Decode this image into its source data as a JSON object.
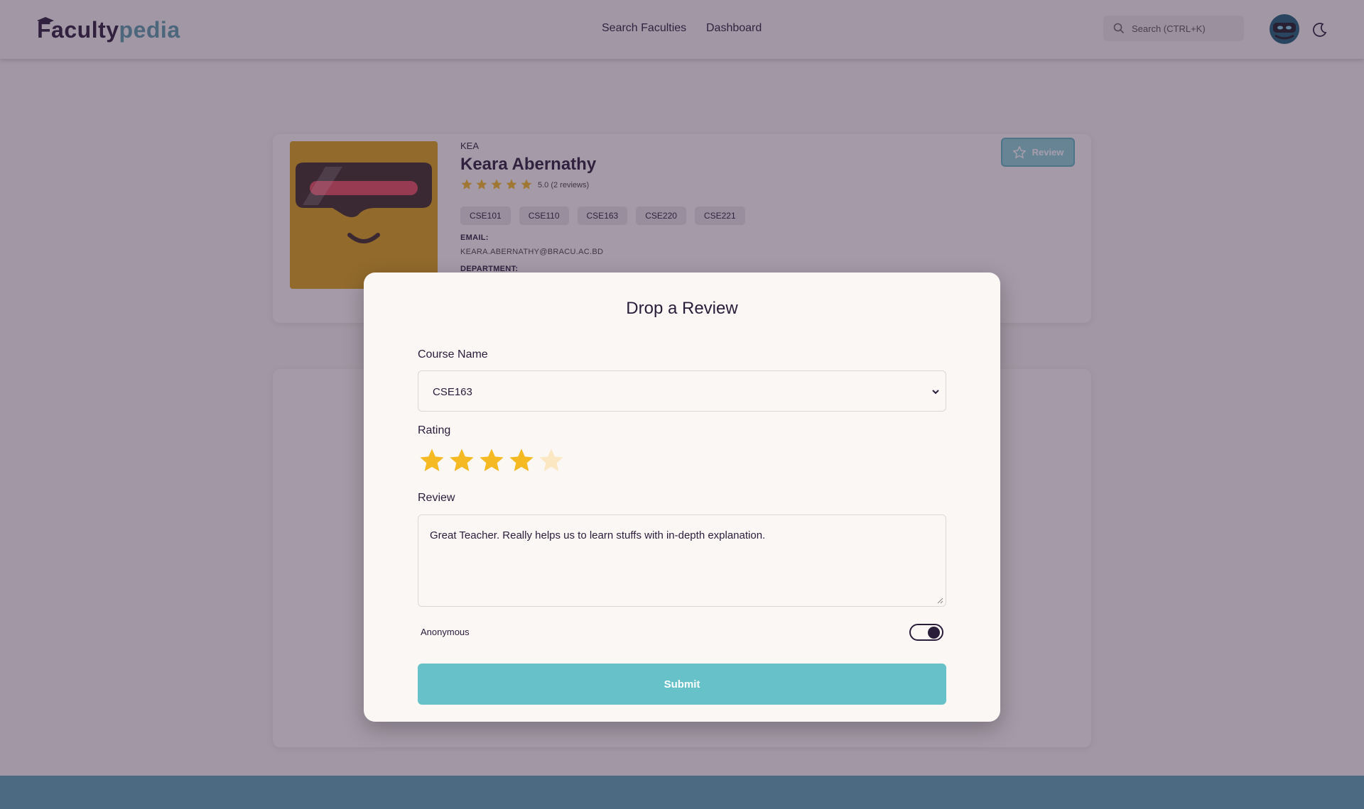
{
  "header": {
    "logo_part1": "Faculty",
    "logo_part2": "pedia",
    "nav": {
      "search_faculties": "Search Faculties",
      "dashboard": "Dashboard"
    },
    "search_placeholder": "Search (CTRL+K)",
    "icons": [
      "graduation-cap-icon",
      "search-icon",
      "user-avatar",
      "moon-icon"
    ]
  },
  "faculty": {
    "initial": "KEA",
    "name": "Keara Abernathy",
    "rating_text": "5.0 (2 reviews)",
    "rating_stars": 5,
    "courses": [
      "CSE101",
      "CSE110",
      "CSE163",
      "CSE220",
      "CSE221"
    ],
    "email_label": "EMAIL:",
    "email": "KEARA.ABERNATHY@BRACU.AC.BD",
    "department_label": "DEPARTMENT:",
    "review_button": "Review"
  },
  "modal": {
    "title": "Drop a Review",
    "course_label": "Course Name",
    "course_value": "CSE163",
    "rating_label": "Rating",
    "rating_value": 4,
    "rating_max": 5,
    "review_label": "Review",
    "review_text": "Great Teacher. Really helps us to learn stuffs with in-depth explanation.",
    "anonymous_label": "Anonymous",
    "anonymous_on": true,
    "submit_label": "Submit"
  },
  "colors": {
    "brand_dark": "#2a1d3a",
    "brand_teal": "#5c9aa8",
    "star": "#f5b923",
    "submit": "#66c2c8",
    "footer": "#5ba3b4"
  }
}
